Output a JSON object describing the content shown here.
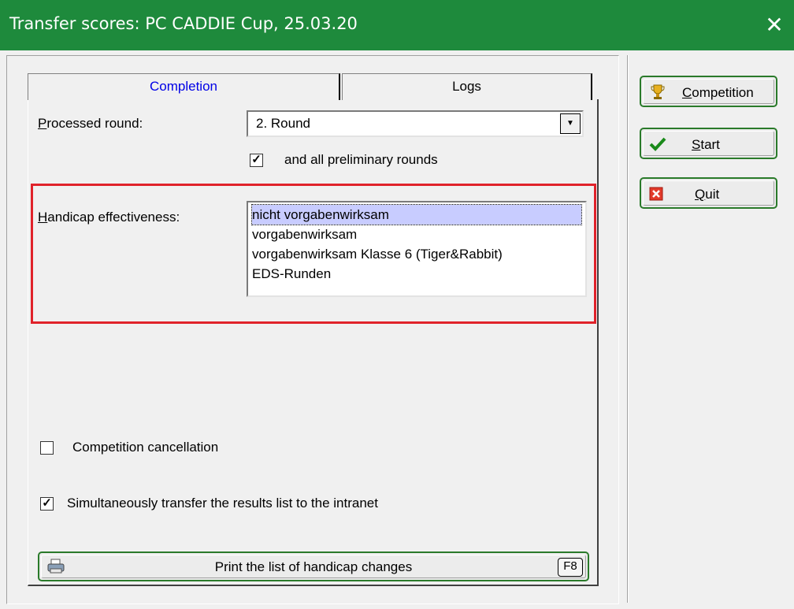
{
  "window": {
    "title": "Transfer scores: PC CADDIE Cup, 25.03.20",
    "close_glyph": "✕"
  },
  "tabs": [
    {
      "label": "Completion",
      "active": true
    },
    {
      "label": "Logs",
      "active": false
    }
  ],
  "processed_round": {
    "label": "Processed round:",
    "value": "2. Round"
  },
  "preliminary": {
    "label": "and all preliminary rounds",
    "checked": true
  },
  "handicap": {
    "label": "Handicap effectiveness:",
    "options": [
      "nicht vorgabenwirksam",
      "vorgabenwirksam",
      "vorgabenwirksam Klasse 6 (Tiger&Rabbit)",
      "EDS-Runden"
    ],
    "selected": "nicht vorgabenwirksam"
  },
  "cancellation": {
    "label": "Competition cancellation",
    "checked": false
  },
  "intranet": {
    "label": "Simultaneously transfer the results list to the intranet",
    "checked": true
  },
  "print_button": {
    "label": "Print the list of handicap changes",
    "hotkey": "F8",
    "icon": "printer-icon"
  },
  "side_buttons": [
    {
      "label": "Competition",
      "icon": "trophy-icon"
    },
    {
      "label": "Start",
      "icon": "checkmark-icon"
    },
    {
      "label": "Quit",
      "icon": "cancel-icon"
    }
  ],
  "colors": {
    "titlebar": "#1e8a3c",
    "highlight": "#e0222a",
    "active_tab": "#0000e6",
    "button_border": "#2a7a2a"
  }
}
